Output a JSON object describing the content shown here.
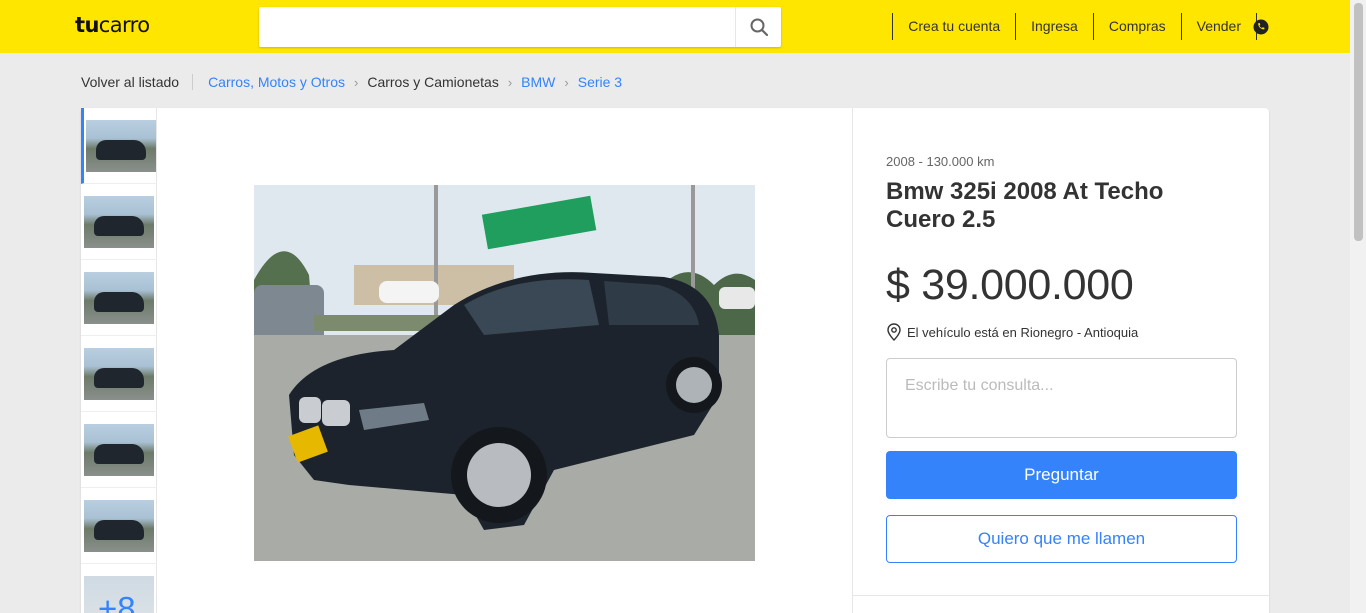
{
  "header": {
    "brand": "tucarro",
    "brand_bold": "tu",
    "brand_light": "carro",
    "search_placeholder": "",
    "nav": [
      {
        "label": "Crea tu cuenta"
      },
      {
        "label": "Ingresa"
      },
      {
        "label": "Compras"
      },
      {
        "label": "Vender"
      }
    ],
    "colors": {
      "brand_yellow": "#ffe600",
      "accent_blue": "#3483fa"
    }
  },
  "breadcrumb": {
    "back": "Volver al listado",
    "items": [
      {
        "label": "Carros, Motos y Otros"
      },
      {
        "label": "Carros y Camionetas"
      },
      {
        "label": "BMW"
      },
      {
        "label": "Serie 3"
      }
    ]
  },
  "gallery": {
    "more_label": "+8"
  },
  "listing": {
    "subtitle": "2008  -  130.000 km",
    "title": "Bmw 325i 2008 At Techo Cuero 2.5",
    "price": "$ 39.000.000",
    "location": "El vehículo está en Rionegro - Antioquia",
    "question_placeholder": "Escribe tu consulta...",
    "ask_button": "Preguntar",
    "call_button": "Quiero que me llamen"
  },
  "icons": {
    "search": "search-icon",
    "phone": "phone-icon",
    "location": "location-pin-icon",
    "chevron": "chevron-right-icon"
  }
}
